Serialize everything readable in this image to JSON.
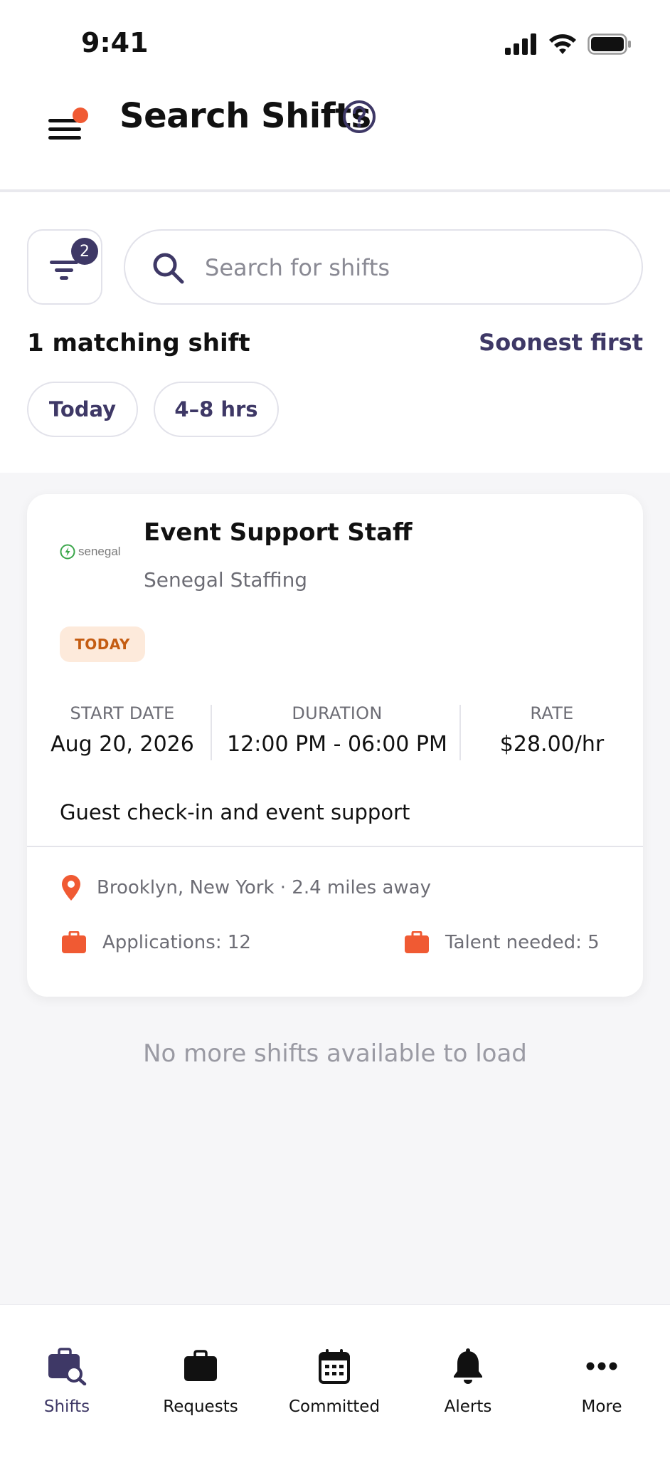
{
  "status_bar": {
    "time": "9:41"
  },
  "header": {
    "title": "Search Shifts"
  },
  "filter": {
    "badge_count": "2"
  },
  "search": {
    "placeholder": "Search for shifts",
    "value": ""
  },
  "results": {
    "count_text": "1 matching shift",
    "sort_label": "Soonest first",
    "chips": [
      "Today",
      "4–8 hrs"
    ]
  },
  "shift_card": {
    "logo_text": "senegal",
    "title": "Event Support Staff",
    "company": "Senegal Staffing",
    "badge": "TODAY",
    "start_date_label": "START DATE",
    "start_date": "Aug 20, 2026",
    "duration_label": "DURATION",
    "duration": "12:00 PM - 06:00 PM",
    "rate_label": "RATE",
    "rate": "$28.00/hr",
    "description": "Guest check-in and event support",
    "location": "Brooklyn, New York · 2.4 miles away",
    "applications": "Applications: 12",
    "talent_needed": "Talent needed: 5"
  },
  "empty_message": "No more shifts available to load",
  "tabbar": {
    "items": [
      {
        "label": "Shifts",
        "icon": "shifts-briefcase-search-icon",
        "active": true
      },
      {
        "label": "Requests",
        "icon": "briefcase-icon",
        "active": false
      },
      {
        "label": "Committed",
        "icon": "calendar-icon",
        "active": false
      },
      {
        "label": "Alerts",
        "icon": "bell-icon",
        "active": false
      },
      {
        "label": "More",
        "icon": "more-dots-icon",
        "active": false
      }
    ]
  },
  "colors": {
    "brand": "#3e3866",
    "accent": "#f05a33",
    "badge_bg": "#fdeadb",
    "badge_text": "#c45c12",
    "muted": "#6d6d75"
  }
}
